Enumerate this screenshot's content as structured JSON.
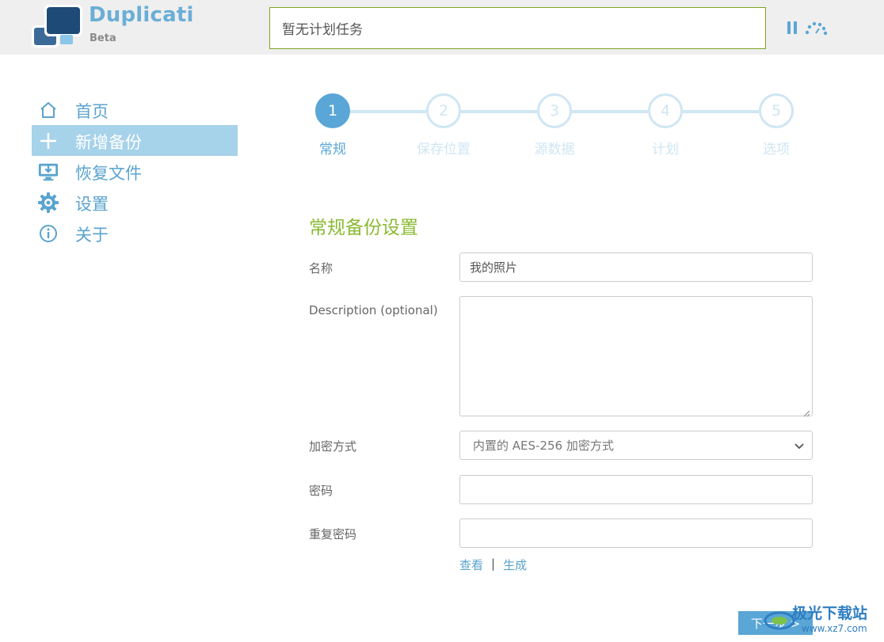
{
  "header": {
    "app_title": "Duplicati",
    "app_subtitle": "Beta",
    "status_text": "暂无计划任务"
  },
  "sidebar": {
    "items": [
      {
        "label": "首页",
        "icon": "home-icon"
      },
      {
        "label": "新增备份",
        "icon": "plus-icon",
        "active": true
      },
      {
        "label": "恢复文件",
        "icon": "restore-icon"
      },
      {
        "label": "设置",
        "icon": "gear-icon"
      },
      {
        "label": "关于",
        "icon": "info-icon"
      }
    ]
  },
  "wizard": {
    "steps": [
      {
        "number": "1",
        "label": "常规",
        "active": true
      },
      {
        "number": "2",
        "label": "保存位置"
      },
      {
        "number": "3",
        "label": "源数据"
      },
      {
        "number": "4",
        "label": "计划"
      },
      {
        "number": "5",
        "label": "选项"
      }
    ]
  },
  "form": {
    "section_title": "常规备份设置",
    "name_label": "名称",
    "name_value": "我的照片",
    "description_label": "Description (optional)",
    "description_value": "",
    "encryption_label": "加密方式",
    "encryption_value": "内置的 AES-256 加密方式",
    "password_label": "密码",
    "password_value": "",
    "repeat_password_label": "重复密码",
    "repeat_password_value": "",
    "show_link": "查看",
    "link_separator": "|",
    "generate_link": "生成",
    "next_button": "下一步 >"
  },
  "watermark": {
    "text": "极光下载站",
    "url": "www.xz7.com"
  },
  "colors": {
    "accent_blue": "#5aa6d6",
    "accent_green": "#8bba33",
    "active_nav_bg": "#a6d2ea",
    "inactive_step": "#cfe6f3"
  }
}
